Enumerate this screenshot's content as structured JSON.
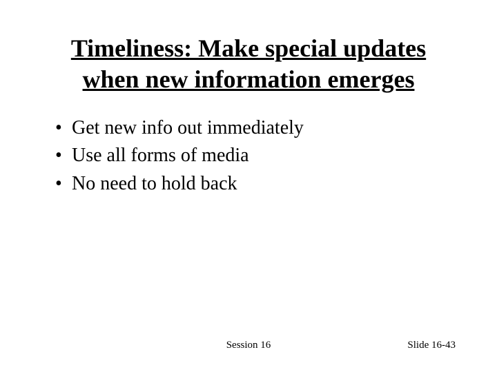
{
  "title": "Timeliness: Make special updates when new information emerges",
  "bullets": [
    "Get new info out immediately",
    "Use all forms of media",
    "No need to hold back"
  ],
  "footer": {
    "center": "Session 16",
    "right": "Slide 16-43"
  }
}
